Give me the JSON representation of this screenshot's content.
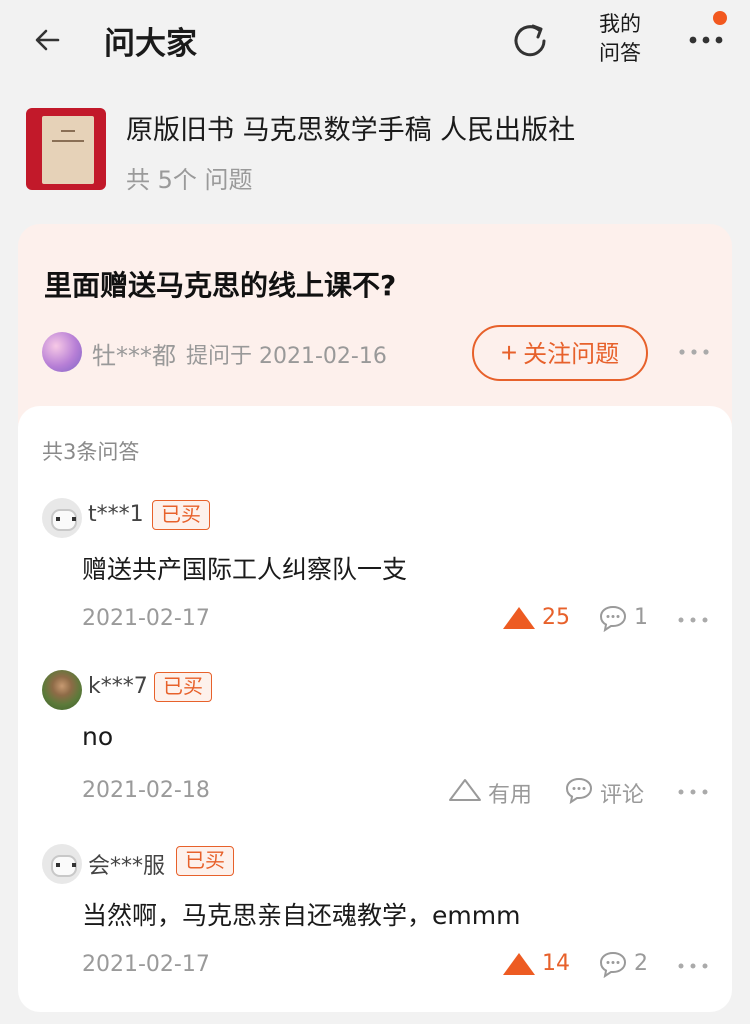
{
  "header": {
    "title": "问大家",
    "my_qa_line1": "我的",
    "my_qa_line2": "问答"
  },
  "product": {
    "title": "原版旧书 马克思数学手稿 人民出版社",
    "question_count": "共 5个 问题"
  },
  "question": {
    "title": "里面赠送马克思的线上课不?",
    "asker": "牡***都",
    "asked_at": "提问于 2021-02-16",
    "follow_label": "关注问题",
    "follow_plus": "+"
  },
  "answers_section": {
    "count_label": "共3条问答",
    "bought_label": "已买",
    "helpful_label": "有用",
    "comment_label": "评论",
    "items": [
      {
        "user": "t***1",
        "text": "赠送共产国际工人纠察队一支",
        "date": "2021-02-17",
        "likes": "25",
        "comments": "1"
      },
      {
        "user": "k***7",
        "text": "no",
        "date": "2021-02-18",
        "likes": "",
        "comments": ""
      },
      {
        "user": "会***服",
        "text": "当然啊，马克思亲自还魂教学，emmm",
        "date": "2021-02-17",
        "likes": "14",
        "comments": "2"
      }
    ]
  },
  "colors": {
    "accent": "#e7612b",
    "notification_dot": "#f2581f",
    "question_card_bg": "#fdf0ec",
    "page_bg": "#f2f2f2"
  },
  "icons": [
    "back-arrow-icon",
    "refresh-icon",
    "more-dots-icon",
    "plus-icon",
    "triangle-up-icon",
    "comment-bubble-icon"
  ]
}
